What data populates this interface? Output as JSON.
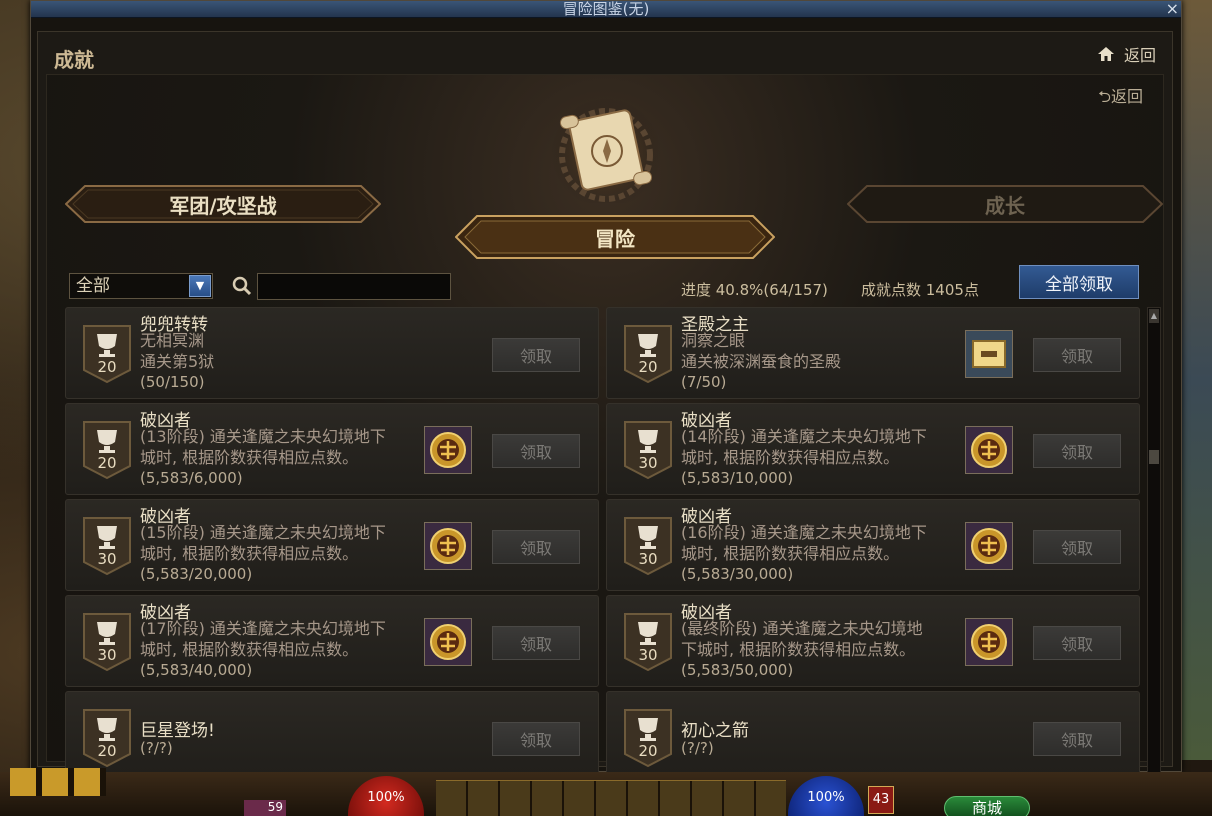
{
  "window": {
    "title": "冒险图鉴(无)",
    "close_label": "×"
  },
  "header": {
    "section_title": "成就",
    "home_back_label": "返回",
    "inner_back_label": "返回"
  },
  "categories": {
    "left": "军团/攻坚战",
    "center": "冒险",
    "right": "成长"
  },
  "filter": {
    "selected": "全部",
    "search_placeholder": ""
  },
  "summary": {
    "progress_label": "进度 40.8%(64/157)",
    "points_label": "成就点数 1405点",
    "claim_all_label": "全部领取"
  },
  "achievements": [
    {
      "points": "20",
      "name": "兜兜转转",
      "desc1": "无相冥渊",
      "desc2": "通关第5狱",
      "progress": "(50/150)",
      "claim": "领取",
      "has_reward": false
    },
    {
      "points": "20",
      "name": "圣殿之主",
      "desc1": "洞察之眼",
      "desc2": "通关被深渊蚕食的圣殿",
      "progress": "(7/50)",
      "claim": "领取",
      "has_reward": true
    },
    {
      "points": "20",
      "name": "破凶者",
      "desc1": "(13阶段) 通关逢魔之未央幻境地下",
      "desc2": "城时, 根据阶数获得相应点数。",
      "progress": "(5,583/6,000)",
      "claim": "领取",
      "has_reward": true
    },
    {
      "points": "30",
      "name": "破凶者",
      "desc1": "(14阶段) 通关逢魔之未央幻境地下",
      "desc2": "城时, 根据阶数获得相应点数。",
      "progress": "(5,583/10,000)",
      "claim": "领取",
      "has_reward": true
    },
    {
      "points": "30",
      "name": "破凶者",
      "desc1": "(15阶段) 通关逢魔之未央幻境地下",
      "desc2": "城时, 根据阶数获得相应点数。",
      "progress": "(5,583/20,000)",
      "claim": "领取",
      "has_reward": true
    },
    {
      "points": "30",
      "name": "破凶者",
      "desc1": "(16阶段) 通关逢魔之未央幻境地下",
      "desc2": "城时, 根据阶数获得相应点数。",
      "progress": "(5,583/30,000)",
      "claim": "领取",
      "has_reward": true
    },
    {
      "points": "30",
      "name": "破凶者",
      "desc1": "(17阶段) 通关逢魔之未央幻境地下",
      "desc2": "城时, 根据阶数获得相应点数。",
      "progress": "(5,583/40,000)",
      "claim": "领取",
      "has_reward": true
    },
    {
      "points": "30",
      "name": "破凶者",
      "desc1": "(最终阶段) 通关逢魔之未央幻境地",
      "desc2": "下城时, 根据阶数获得相应点数。",
      "progress": "(5,583/50,000)",
      "claim": "领取",
      "has_reward": true
    },
    {
      "points": "20",
      "name": "巨星登场!",
      "desc1": "",
      "desc2": "",
      "progress": "(?/?)",
      "claim": "领取",
      "has_reward": false
    },
    {
      "points": "20",
      "name": "初心之箭",
      "desc1": "",
      "desc2": "",
      "progress": "(?/?)",
      "claim": "领取",
      "has_reward": false
    }
  ],
  "hud": {
    "hp": "100%",
    "mp": "100%",
    "level": "43",
    "shop_label": "商城",
    "item_count": "59"
  },
  "colors": {
    "accent_gold": "#cdb994",
    "claim_all_blue": "#335a93",
    "disabled_button": "#3b3a38"
  }
}
